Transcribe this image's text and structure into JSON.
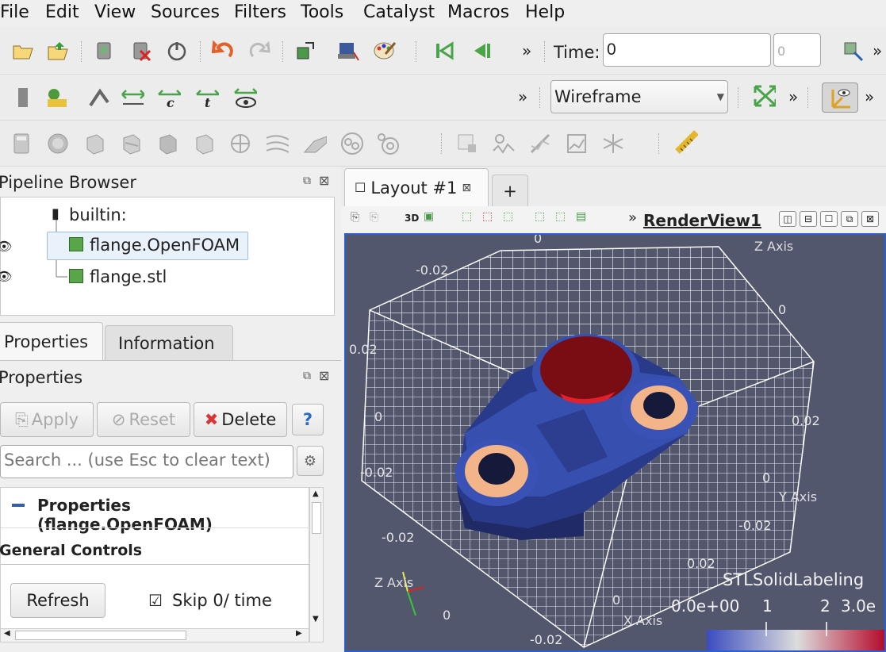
{
  "menu": [
    "File",
    "Edit",
    "View",
    "Sources",
    "Filters",
    "Tools",
    "Catalyst",
    "Macros",
    "Help"
  ],
  "toolbar1": {
    "time_label": "Time:",
    "time_value": "0",
    "time_index": "0"
  },
  "toolbar2": {
    "representation": "Wireframe"
  },
  "pipeline": {
    "title": "Pipeline Browser",
    "root": "builtin:",
    "items": [
      "flange.OpenFOAM",
      "flange.stl"
    ]
  },
  "props": {
    "tabs": [
      "Properties",
      "Information"
    ],
    "title": "Properties",
    "apply": "Apply",
    "reset": "Reset",
    "delete": "Delete",
    "help": "?",
    "search_placeholder": "Search ... (use Esc to clear text)",
    "section": "Properties (flange.OpenFOAM)",
    "group": "General Controls",
    "refresh": "Refresh",
    "skip_label": "Skip 0/ time",
    "skip_checked": true
  },
  "layout": {
    "tab": "Layout #1",
    "add": "+",
    "view_name": "RenderView1",
    "view3d": "3D"
  },
  "render": {
    "background": "#52576e",
    "axis_labels": [
      "Z Axis",
      "Y Axis",
      "X Axis",
      "Z Axis"
    ],
    "ticks": [
      "-0.02",
      "0",
      "0.02",
      "0.02",
      "0",
      "-0.02",
      "-0.02",
      "0",
      "0.02",
      "0",
      "-0.02",
      "0.02",
      "0",
      "-0.02",
      "0"
    ],
    "legend_title": "STLSolidLabeling",
    "legend_labels": [
      "0.0e+00",
      "1",
      "2",
      "3.0e"
    ]
  }
}
